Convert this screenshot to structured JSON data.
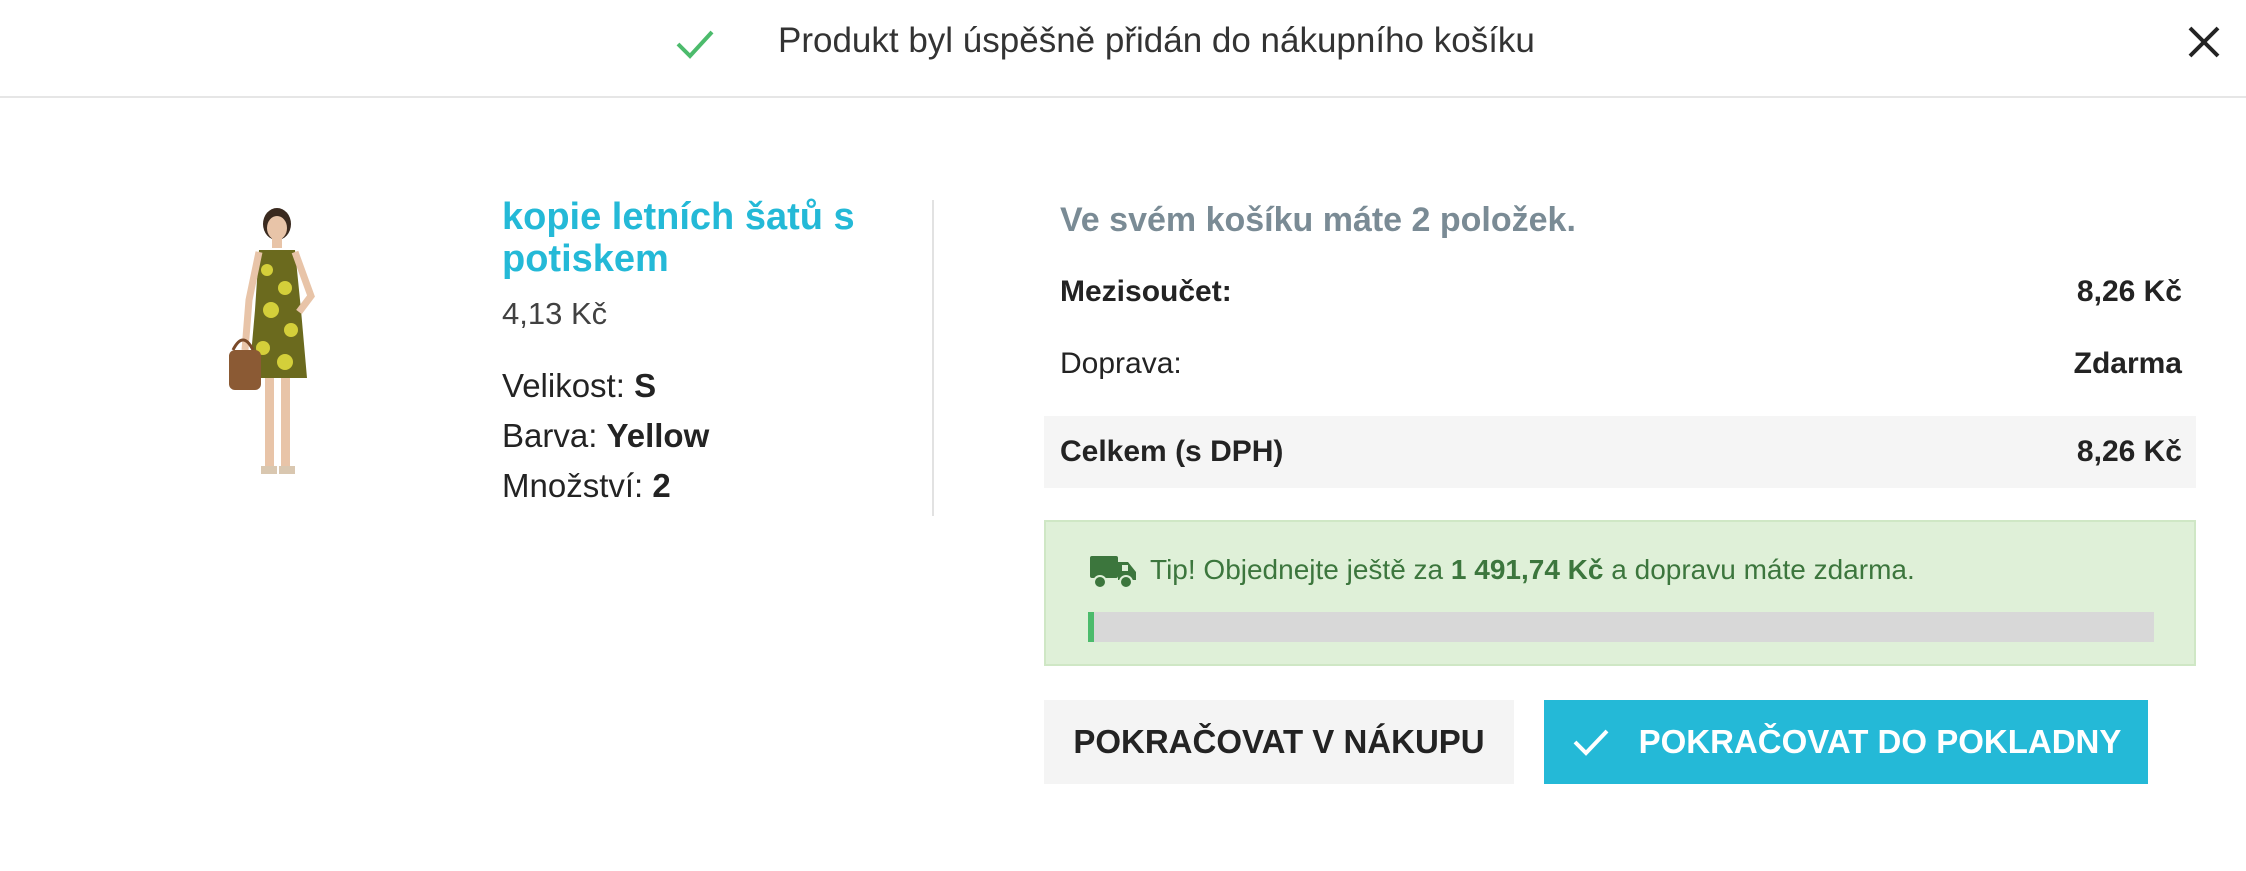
{
  "header": {
    "title": "Produkt byl úspěšně přidán do nákupního košíku",
    "check_icon": "check-icon",
    "close_icon": "close-icon",
    "accent_color": "#4cbb6c"
  },
  "product": {
    "name": "kopie letních šatů s potiskem",
    "price": "4,13 Kč",
    "image_icon": "product-photo",
    "attributes": [
      {
        "label": "Velikost:",
        "value": "S"
      },
      {
        "label": "Barva:",
        "value": "Yellow"
      },
      {
        "label": "Množství:",
        "value": "2"
      }
    ],
    "name_color": "#24b9d7"
  },
  "cart": {
    "count_text": "Ve svém košíku máte 2 položek.",
    "subtotal_label": "Mezisoučet:",
    "subtotal_value": "8,26 Kč",
    "shipping_label": "Doprava:",
    "shipping_value": "Zdarma",
    "total_label": "Celkem (s DPH)",
    "total_value": "8,26 Kč"
  },
  "tip": {
    "prefix": "Tip! Objednejte ještě za",
    "amount": "1 491,74 Kč",
    "suffix": "a dopravu máte zdarma.",
    "truck_icon": "truck-icon",
    "progress_fraction": 0.005,
    "color": "#3c763d"
  },
  "buttons": {
    "continue_label": "POKRAČOVAT V NÁKUPU",
    "checkout_label": "POKRAČOVAT DO POKLADNY",
    "checkout_color": "#24b9d7"
  }
}
